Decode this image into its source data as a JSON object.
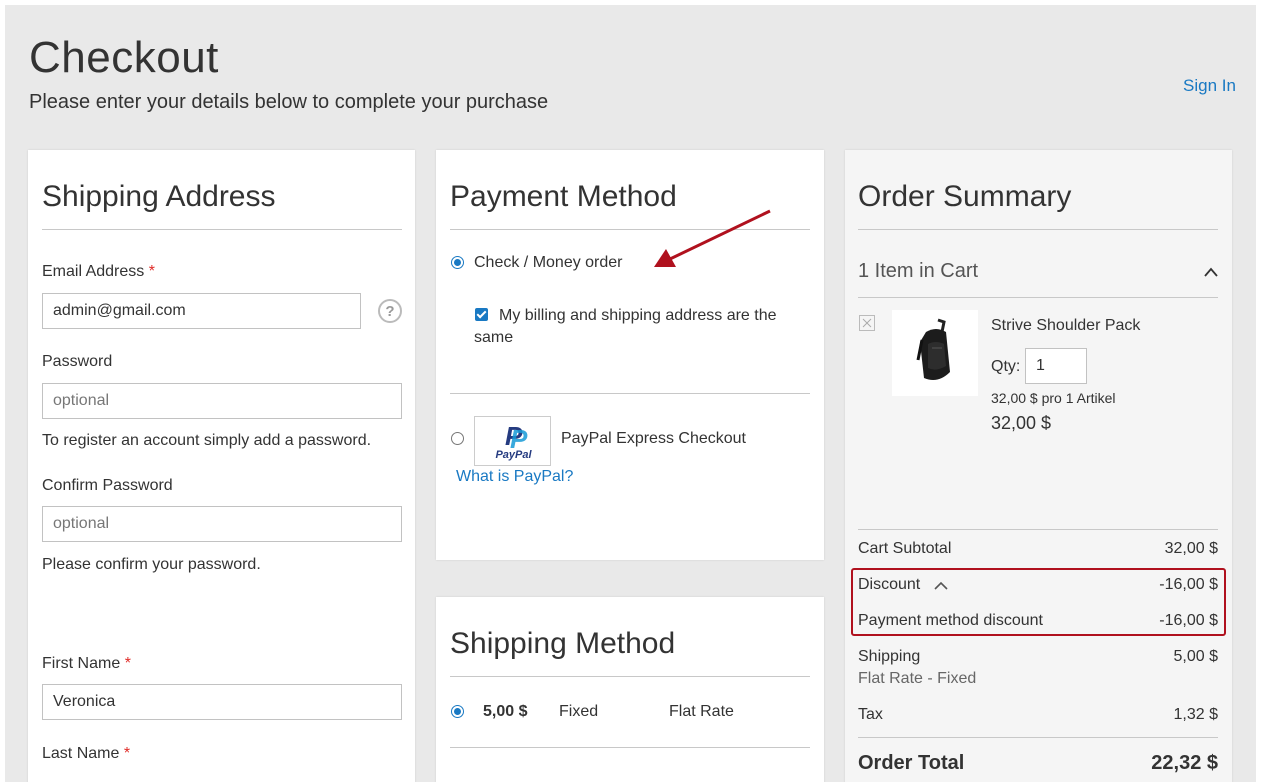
{
  "header": {
    "title": "Checkout",
    "subtitle": "Please enter your details below to complete your purchase",
    "sign_in": "Sign In"
  },
  "shipping_address": {
    "title": "Shipping Address",
    "email_label": "Email Address",
    "email_value": "admin@gmail.com",
    "required_mark": "*",
    "password_label": "Password",
    "password_placeholder": "optional",
    "password_note": "To register an account simply add a password.",
    "confirm_label": "Confirm Password",
    "confirm_placeholder": "optional",
    "confirm_note": "Please confirm your password.",
    "first_name_label": "First Name",
    "first_name_value": "Veronica",
    "last_name_label": "Last Name",
    "help_icon": "question-circle-icon"
  },
  "payment": {
    "title": "Payment Method",
    "option1": "Check / Money order",
    "billing_same": "My billing and shipping address are the same",
    "option2": "PayPal Express Checkout",
    "paypal_logo_text": "PayPal",
    "what_is_paypal": "What is PayPal?"
  },
  "shipping_method": {
    "title": "Shipping Method",
    "price": "5,00 $",
    "method": "Fixed",
    "carrier": "Flat Rate"
  },
  "summary": {
    "title": "Order Summary",
    "items_in_cart": "1 Item in Cart",
    "product_name": "Strive Shoulder Pack",
    "qty_label": "Qty:",
    "qty_value": "1",
    "unit_price": "32,00 $ pro 1 Artikel",
    "price": "32,00 $",
    "subtotal_label": "Cart Subtotal",
    "subtotal_value": "32,00 $",
    "discount_label": "Discount",
    "discount_value": "-16,00 $",
    "payment_discount_label": "Payment method discount",
    "payment_discount_value": "-16,00 $",
    "shipping_label": "Shipping",
    "shipping_sub": "Flat Rate - Fixed",
    "shipping_value": "5,00 $",
    "tax_label": "Tax",
    "tax_value": "1,32 $",
    "total_label": "Order Total",
    "total_value": "22,32 $"
  },
  "colors": {
    "accent": "#1979c3",
    "highlight": "#b0111e",
    "required": "#e02b27"
  }
}
